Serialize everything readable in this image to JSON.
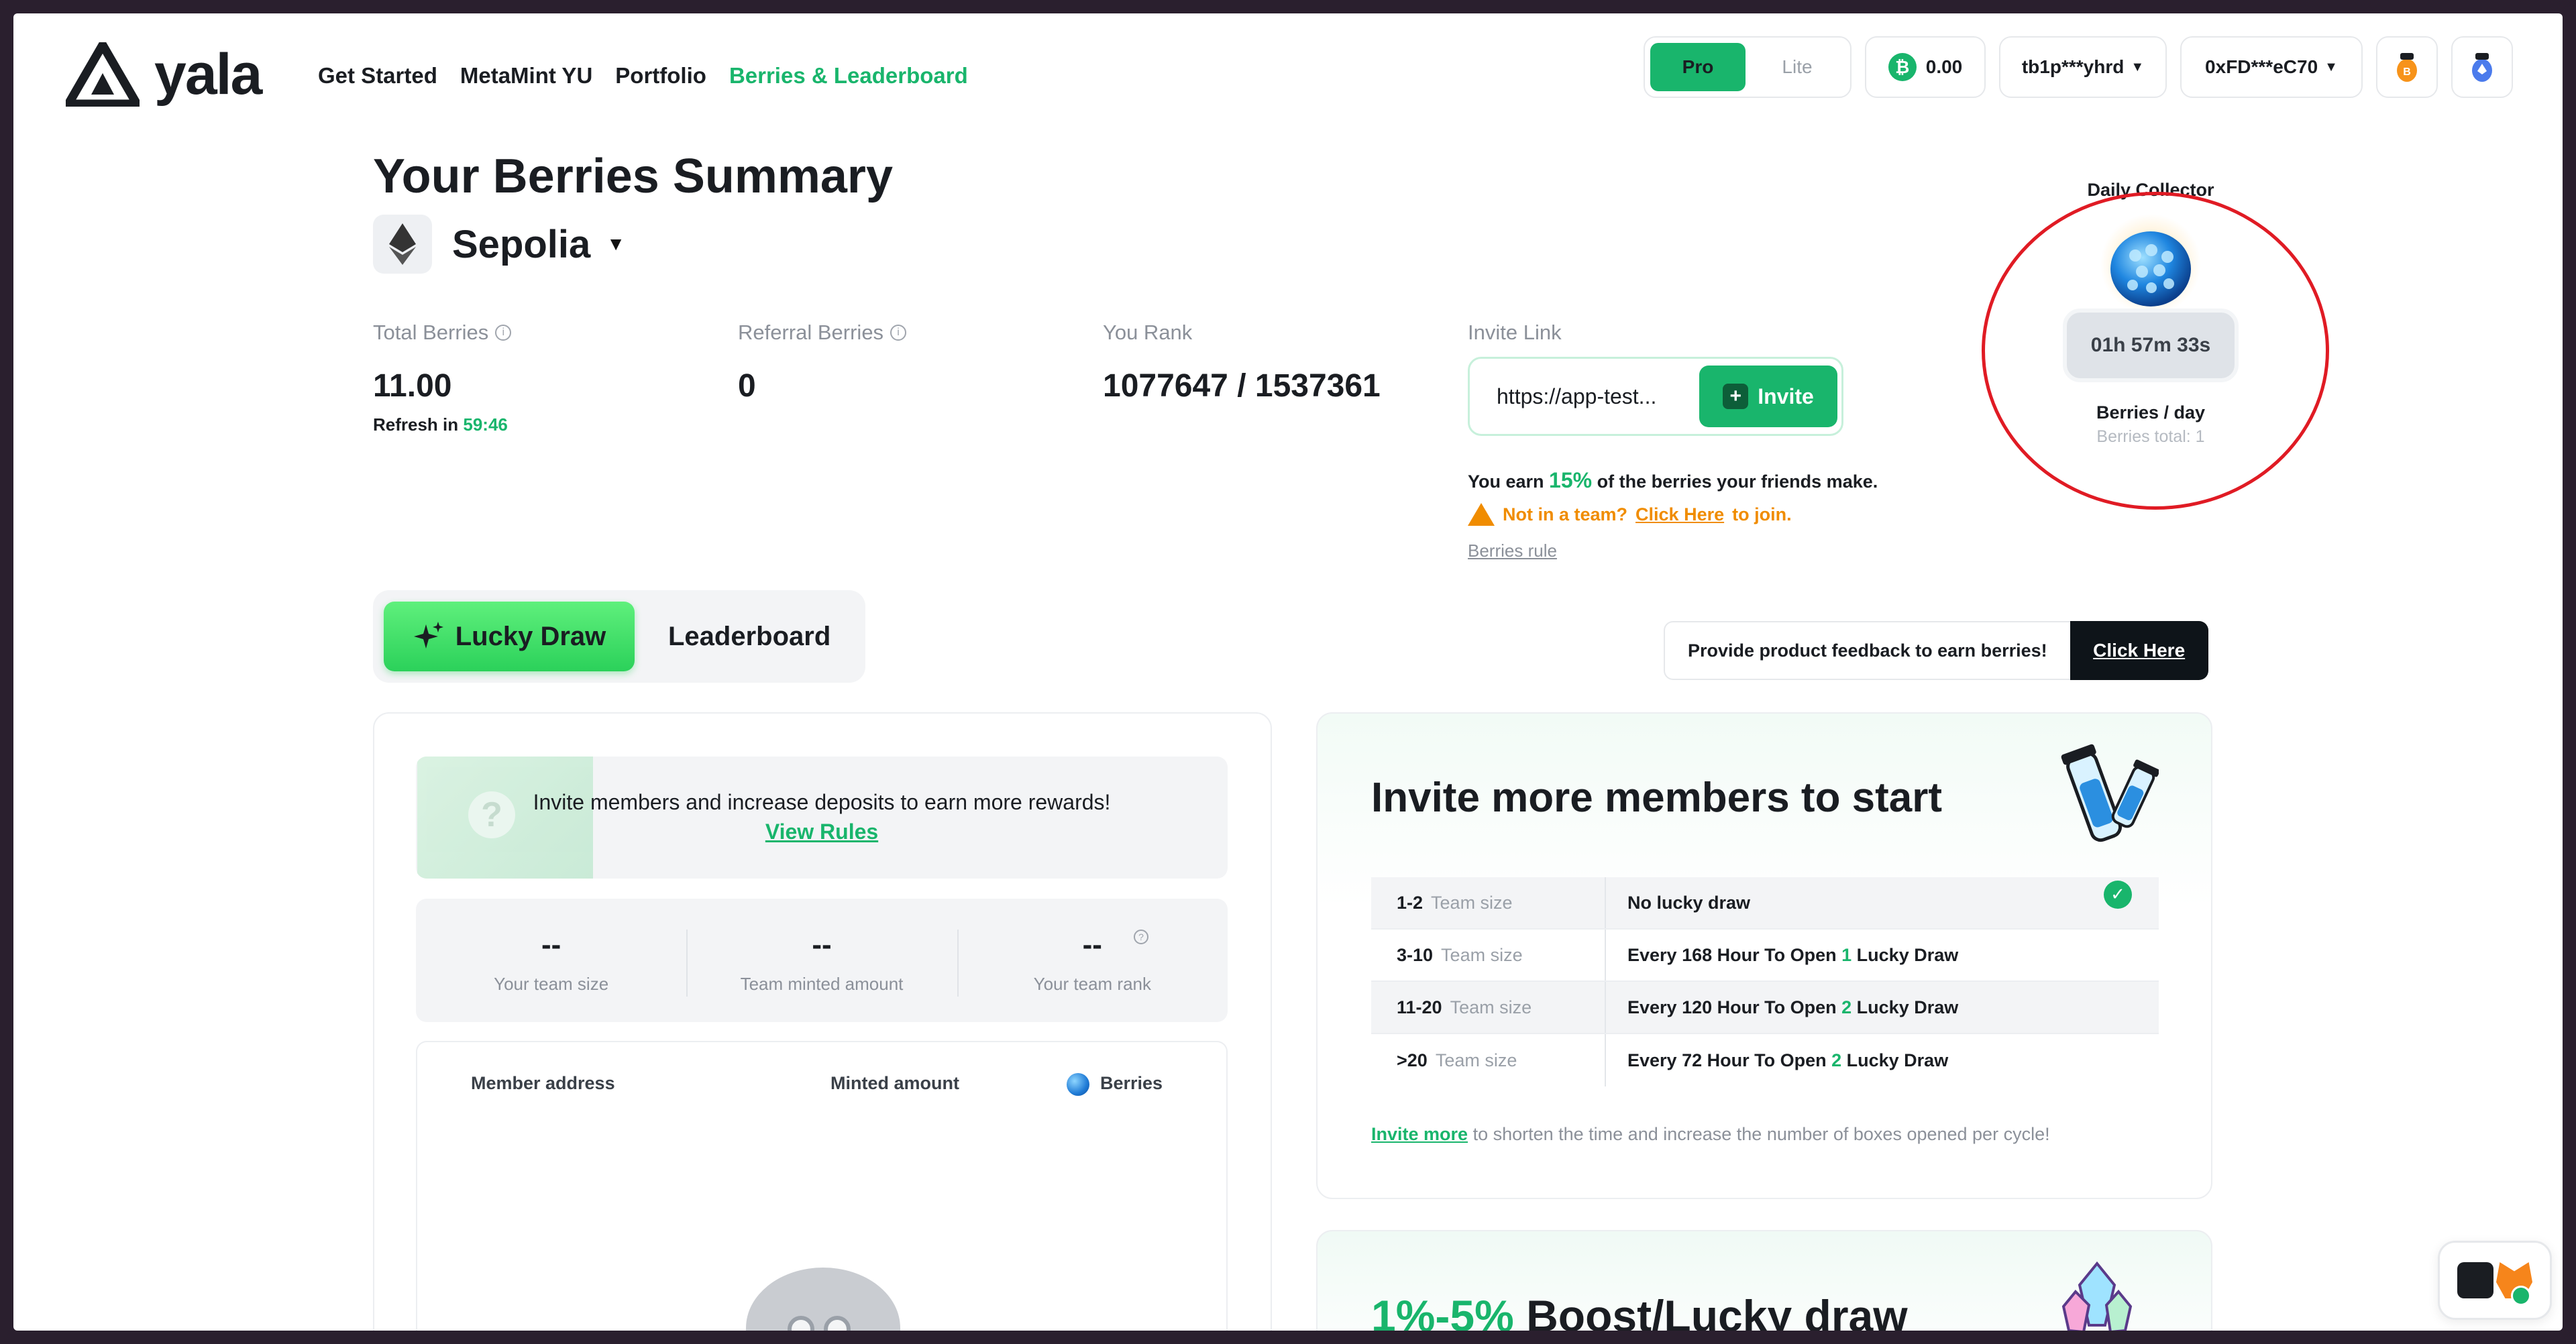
{
  "brand": {
    "name": "yala"
  },
  "nav": {
    "items": [
      "Get Started",
      "MetaMint YU",
      "Portfolio",
      "Berries & Leaderboard"
    ],
    "active": "Berries & Leaderboard"
  },
  "header": {
    "mode_pro": "Pro",
    "mode_lite": "Lite",
    "btc_symbol": "₿",
    "btc_balance": "0.00",
    "btc_address": "tb1p***yhrd",
    "evm_address": "0xFD***eC70"
  },
  "summary": {
    "title": "Your Berries Summary",
    "network": "Sepolia",
    "total_berries_label": "Total Berries",
    "total_berries_value": "11.00",
    "refresh_label": "Refresh in",
    "refresh_time": "59:46",
    "referral_label": "Referral Berries",
    "referral_value": "0",
    "rank_label": "You Rank",
    "rank_value": "1077647 / 1537361",
    "invite_label": "Invite Link",
    "invite_url": "https://app-test...",
    "invite_button": "Invite",
    "earn_prefix": "You earn",
    "earn_pct": "15%",
    "earn_suffix": "of the berries your friends make.",
    "team_prefix": "Not in a team?",
    "team_link": "Click Here",
    "team_suffix": "to join.",
    "rules_link": "Berries rule"
  },
  "collector": {
    "title": "Daily Collector",
    "timer": "01h 57m 33s",
    "per_day": "Berries / day",
    "total": "Berries total: 1"
  },
  "tabs": {
    "lucky_draw": "Lucky Draw",
    "leaderboard": "Leaderboard",
    "active": "Lucky Draw"
  },
  "feedback": {
    "text": "Provide product feedback to earn berries!",
    "button": "Click Here"
  },
  "left_card": {
    "banner_text": "Invite members and increase deposits to earn more rewards!",
    "banner_link": "View Rules",
    "stats": [
      {
        "value": "--",
        "label": "Your team size"
      },
      {
        "value": "--",
        "label": "Team minted amount"
      },
      {
        "value": "--",
        "label": "Your team rank"
      }
    ],
    "columns": [
      "Member address",
      "Minted amount",
      "Berries"
    ]
  },
  "right_card": {
    "title": "Invite more members to start",
    "team_size_label": "Team size",
    "tiers": [
      {
        "range": "1-2",
        "pre": "No lucky draw",
        "n": "",
        "post": "",
        "done": true
      },
      {
        "range": "3-10",
        "pre": "Every 168 Hour To Open",
        "n": "1",
        "post": "Lucky Draw",
        "done": false
      },
      {
        "range": "11-20",
        "pre": "Every 120 Hour To Open",
        "n": "2",
        "post": "Lucky Draw",
        "done": false
      },
      {
        "range": ">20",
        "pre": "Every 72 Hour To Open",
        "n": "2",
        "post": "Lucky Draw",
        "done": false
      }
    ],
    "foot_link": "Invite more",
    "foot_text": "to shorten the time and increase the number of boxes opened per cycle!"
  },
  "boost_card": {
    "pct": "1%-5%",
    "text": "Boost/Lucky draw"
  },
  "colors": {
    "accent": "#19b56c",
    "warning": "#f08c00",
    "highlight_circle": "#e01b24"
  }
}
